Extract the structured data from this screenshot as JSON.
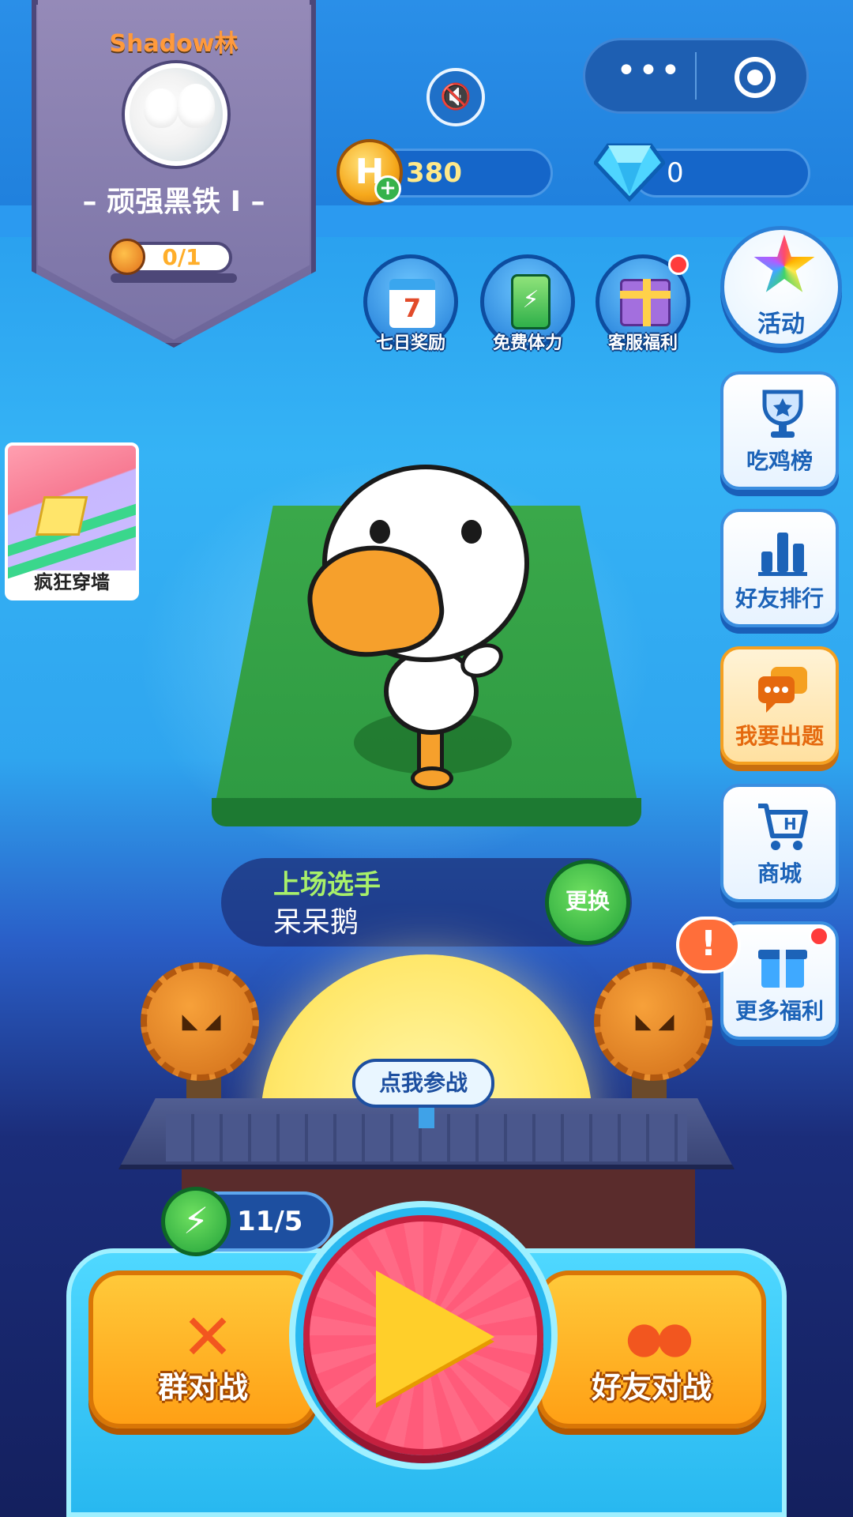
{
  "profile": {
    "username": "Shadow林",
    "rank": "– 顽强黑铁 Ⅰ –",
    "food_progress": "0/1"
  },
  "topbar": {
    "menu_dots": "•••",
    "sound_icon": "speaker-muted-icon"
  },
  "currency": {
    "coins": "380",
    "coin_symbol": "H",
    "coin_plus": "+",
    "gems": "0"
  },
  "features": [
    {
      "label": "七日奖励",
      "icon": "calendar-icon",
      "calendar_day": "7"
    },
    {
      "label": "免费体力",
      "icon": "battery-icon",
      "symbol": "⚡"
    },
    {
      "label": "客服福利",
      "icon": "gift-icon"
    }
  ],
  "activity": {
    "label": "活动",
    "icon": "rainbow-star-icon"
  },
  "side_buttons": [
    {
      "label": "吃鸡榜",
      "icon": "trophy-icon"
    },
    {
      "label": "好友排行",
      "icon": "bar-chart-icon"
    },
    {
      "label": "我要出题",
      "icon": "chat-bubble-icon"
    },
    {
      "label": "商城",
      "icon": "shopping-cart-icon",
      "cart_symbol": "H"
    },
    {
      "label": "更多福利",
      "icon": "gift-box-icon"
    }
  ],
  "alert_symbol": "!",
  "mini_game": {
    "label": "疯狂穿墙"
  },
  "player": {
    "title": "上场选手",
    "name": "呆呆鹅",
    "swap_label": "更换"
  },
  "mooncake": {
    "face": "◣ ◢"
  },
  "join_tag": "点我参战",
  "energy": {
    "value": "11/5",
    "symbol": "⚡"
  },
  "bottom": {
    "group_battle": "群对战",
    "friend_battle": "好友对战",
    "group_icon": "✕",
    "friend_icon": "●●"
  },
  "colors": {
    "accent_orange": "#ffa015",
    "play_red": "#ff5b7a",
    "sky_blue": "#35b3f5"
  }
}
